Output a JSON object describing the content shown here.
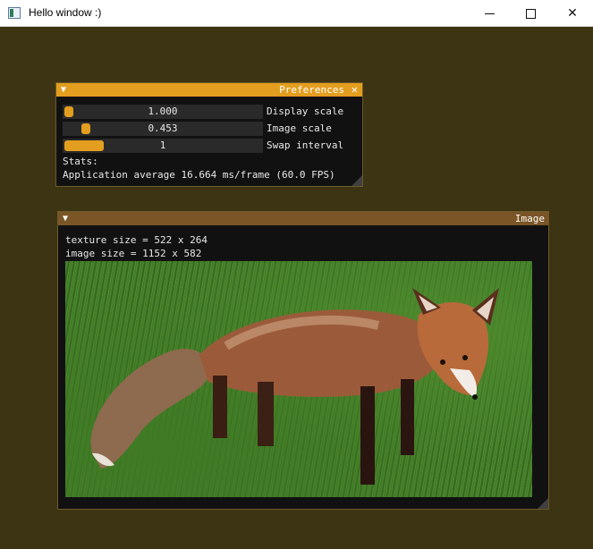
{
  "window": {
    "title": "Hello window :)",
    "minimize_glyph": "",
    "maximize_glyph": "",
    "close_glyph": "✕"
  },
  "preferences": {
    "title": "Preferences",
    "collapse_glyph": "▼",
    "close_glyph": "✕",
    "sliders": [
      {
        "value_text": "1.000",
        "label": "Display scale",
        "fraction": 0.0
      },
      {
        "value_text": "0.453",
        "label": "Image scale",
        "fraction": 0.1
      },
      {
        "value_text": "1",
        "label": "Swap interval",
        "fraction": 0.0
      }
    ],
    "stats_label": "Stats:",
    "stats_text": "Application average 16.664 ms/frame (60.0 FPS)"
  },
  "image_window": {
    "title": "Image",
    "collapse_glyph": "▼",
    "texture_size": "texture size = 522 x 264",
    "image_size": "image size = 1152 x 582"
  },
  "colors": {
    "background": "#3d3413",
    "accent": "#e39e1f",
    "image_titlebar": "#7a5526"
  },
  "icons": {
    "collapse": "triangle-down",
    "close": "x-mark",
    "resize": "corner-grip"
  }
}
